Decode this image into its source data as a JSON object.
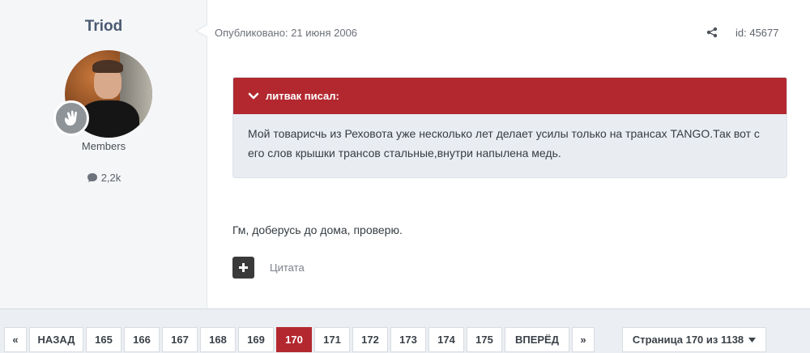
{
  "author": {
    "name": "Triod",
    "group": "Members",
    "post_count": "2,2k"
  },
  "post": {
    "date": "Опубликовано: 21 июня 2006",
    "id": "id: 45677",
    "quote": {
      "header": "литвак писал:",
      "text": "Мой товарисчь из Реховота уже несколько лет делает усилы только на трансах TANGO.Так вот с его слов крышки трансов стальные,внутри напылена медь."
    },
    "text": "Гм, доберусь до дома, проверю.",
    "quote_button": "Цитата"
  },
  "pagination": {
    "first": "«",
    "prev": "НАЗАД",
    "pages": [
      "165",
      "166",
      "167",
      "168",
      "169",
      "170",
      "171",
      "172",
      "173",
      "174",
      "175"
    ],
    "current": "170",
    "next": "ВПЕРЁД",
    "last": "»",
    "jump": "Страница 170 из 1138"
  },
  "colors": {
    "accent": "#b3282f",
    "background": "#ebeef2"
  }
}
